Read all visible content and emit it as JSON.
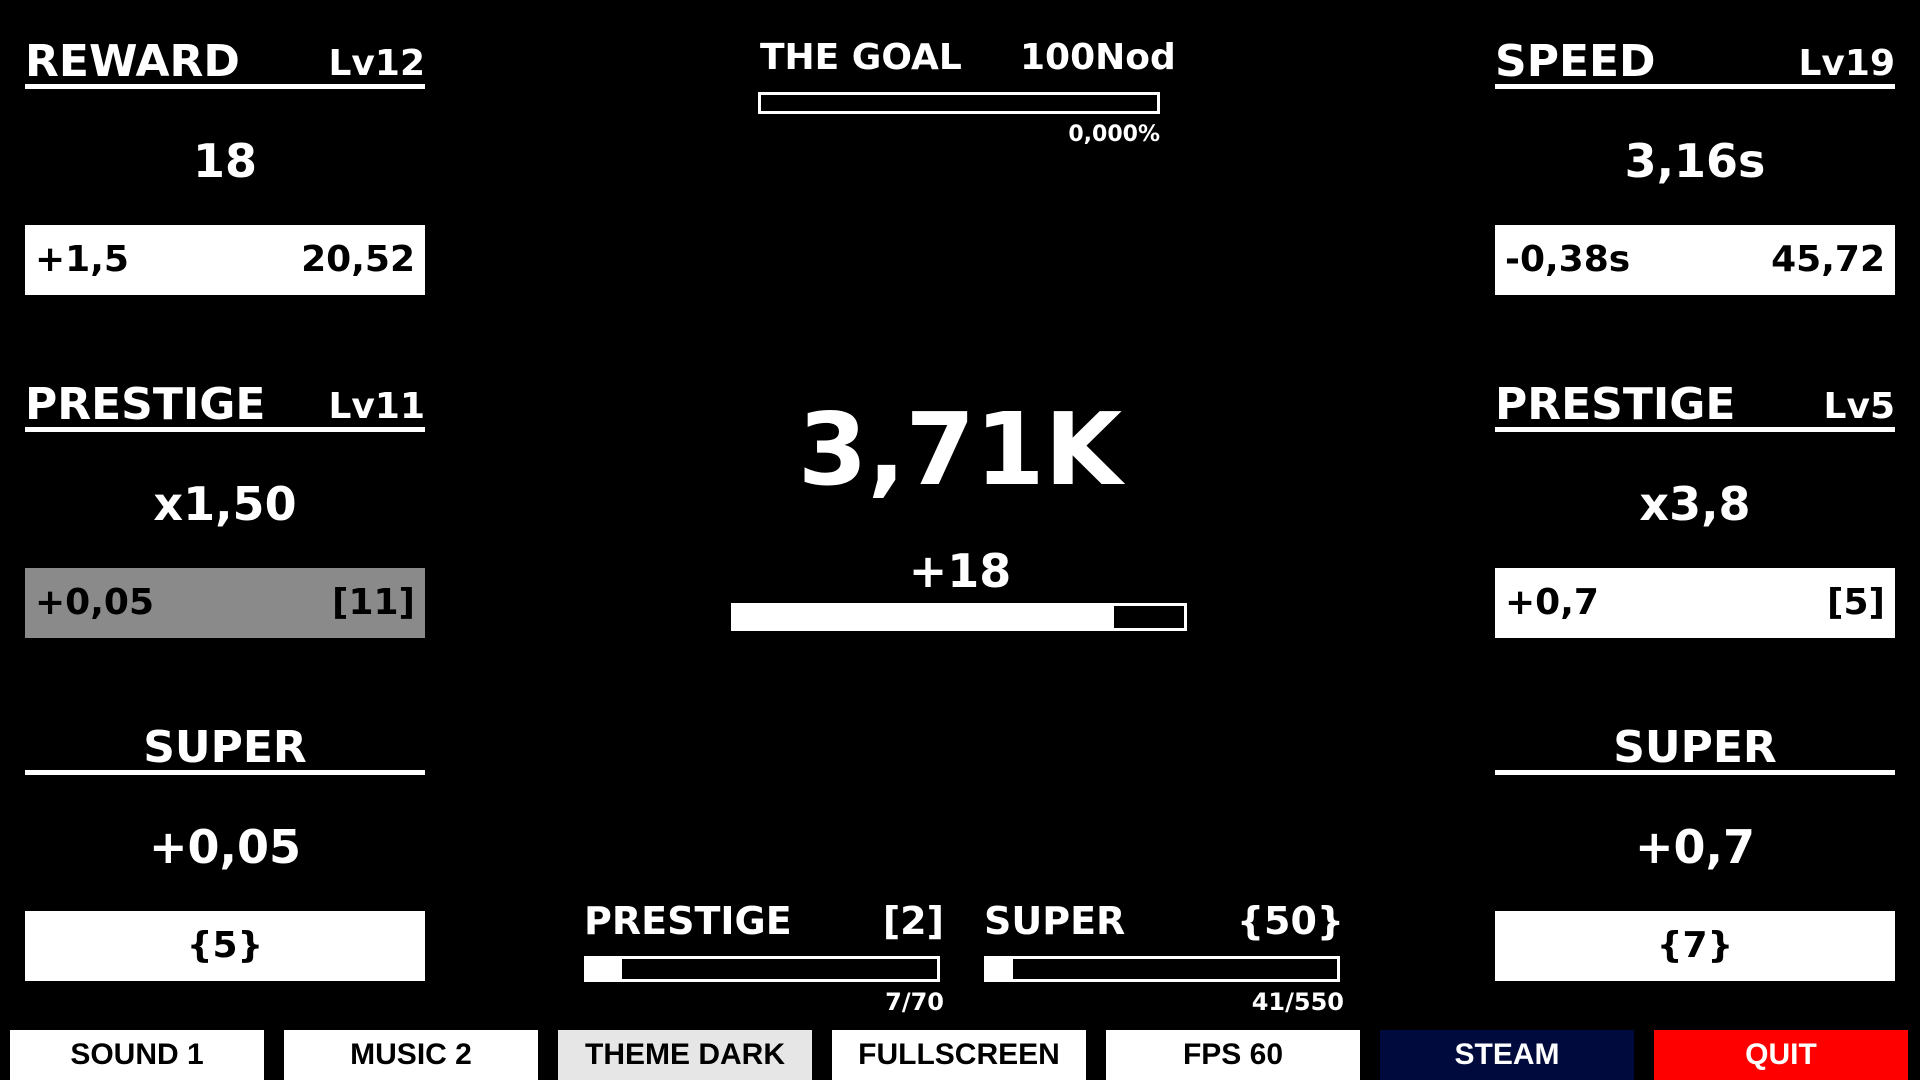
{
  "left": {
    "reward": {
      "title": "REWARD",
      "level": "Lv12",
      "value": "18",
      "btn_left": "+1,5",
      "btn_right": "20,52"
    },
    "prestige": {
      "title": "PRESTIGE",
      "level": "Lv11",
      "value": "x1,50",
      "btn_left": "+0,05",
      "btn_right": "[11]"
    },
    "super": {
      "title": "SUPER",
      "value": "+0,05",
      "btn": "{5}"
    }
  },
  "right": {
    "speed": {
      "title": "SPEED",
      "level": "Lv19",
      "value": "3,16s",
      "btn_left": "-0,38s",
      "btn_right": "45,72"
    },
    "prestige": {
      "title": "PRESTIGE",
      "level": "Lv5",
      "value": "x3,8",
      "btn_left": "+0,7",
      "btn_right": "[5]"
    },
    "super": {
      "title": "SUPER",
      "value": "+0,7",
      "btn": "{7}"
    }
  },
  "goal": {
    "label": "THE GOAL",
    "amount": "100Nod",
    "percent_text": "0,000%",
    "progress": 0.0
  },
  "main": {
    "value": "3,71K",
    "gain": "+18",
    "progress": 0.845
  },
  "meters": {
    "prestige": {
      "title": "PRESTIGE",
      "value": "[2]",
      "count": "7/70",
      "progress": 0.1
    },
    "super": {
      "title": "SUPER",
      "value": "{50}",
      "count": "41/550",
      "progress": 0.0745
    }
  },
  "menu": {
    "sound": "SOUND 1",
    "music": "MUSIC 2",
    "theme": "THEME DARK",
    "fullscreen": "FULLSCREEN",
    "fps": "FPS 60",
    "steam": "STEAM",
    "quit": "QUIT"
  },
  "colors": {
    "background": "#000000",
    "foreground": "#ffffff",
    "disabled_button": "#8a8a8a",
    "theme_button": "#e6e6e6",
    "steam_button": "#000a3c",
    "quit_button": "#ff0000"
  }
}
